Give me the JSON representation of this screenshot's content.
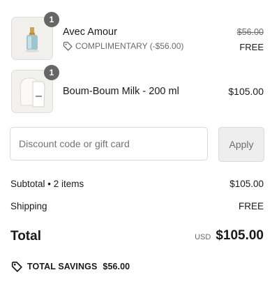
{
  "items": [
    {
      "name": "Avec Amour",
      "quantity": "1",
      "discount_label": "COMPLIMENTARY (-$56.00)",
      "original_price": "$56.00",
      "price": "FREE"
    },
    {
      "name": "Boum-Boum Milk - 200 ml",
      "quantity": "1",
      "price": "$105.00"
    }
  ],
  "discount": {
    "placeholder": "Discount code or gift card",
    "apply_label": "Apply"
  },
  "summary": {
    "subtotal_label": "Subtotal • 2 items",
    "subtotal_value": "$105.00",
    "shipping_label": "Shipping",
    "shipping_value": "FREE",
    "total_label": "Total",
    "currency": "USD",
    "total_value": "$105.00",
    "savings_label": "TOTAL SAVINGS",
    "savings_value": "$56.00"
  },
  "icons": {
    "discount_tag": "tag-icon",
    "savings_tag": "tag-icon"
  }
}
